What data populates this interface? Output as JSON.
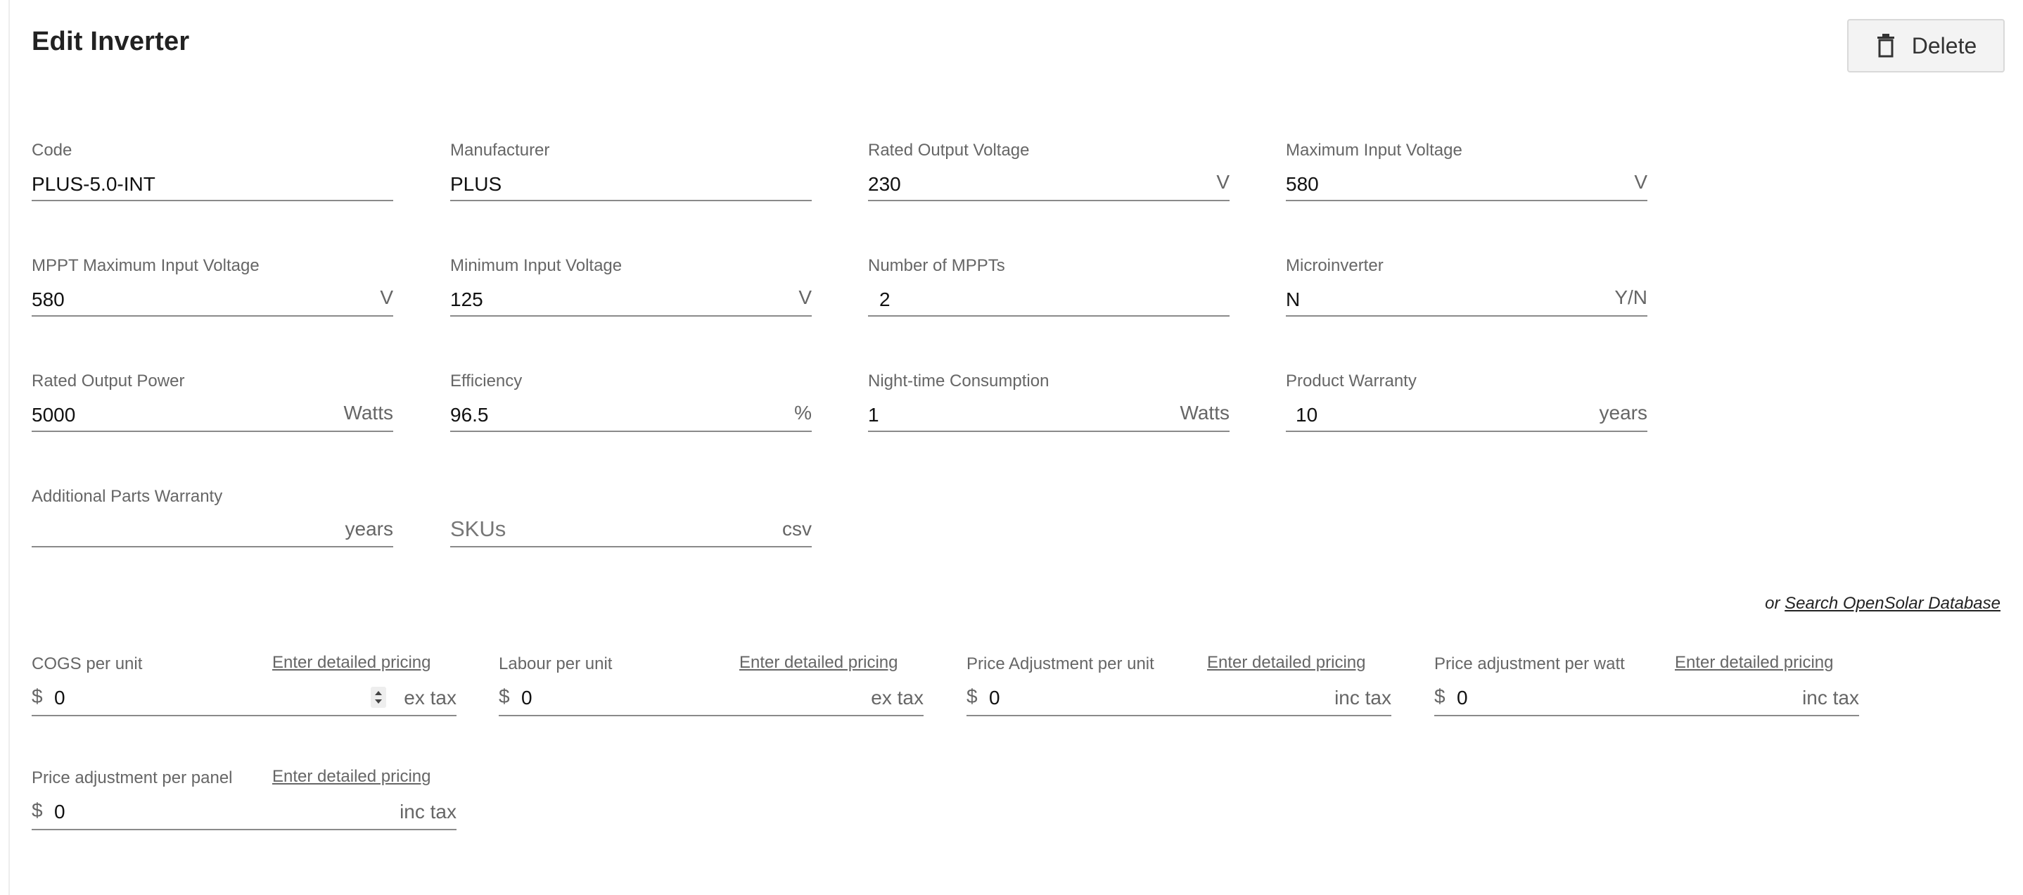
{
  "header": {
    "title": "Edit Inverter",
    "delete_label": "Delete"
  },
  "fields": {
    "code": {
      "label": "Code",
      "value": "PLUS-5.0-INT"
    },
    "manufacturer": {
      "label": "Manufacturer",
      "value": "PLUS"
    },
    "rated_output_voltage": {
      "label": "Rated Output Voltage",
      "value": "230",
      "unit": "V"
    },
    "max_input_voltage": {
      "label": "Maximum Input Voltage",
      "value": "580",
      "unit": "V"
    },
    "mppt_max_input_voltage": {
      "label": "MPPT Maximum Input Voltage",
      "value": "580",
      "unit": "V"
    },
    "min_input_voltage": {
      "label": "Minimum Input Voltage",
      "value": "125",
      "unit": "V"
    },
    "num_mppts": {
      "label": "Number of MPPTs",
      "value": "2"
    },
    "microinverter": {
      "label": "Microinverter",
      "value": "N",
      "unit": "Y/N"
    },
    "rated_output_power": {
      "label": "Rated Output Power",
      "value": "5000",
      "unit": "Watts"
    },
    "efficiency": {
      "label": "Efficiency",
      "value": "96.5",
      "unit": "%"
    },
    "night_consumption": {
      "label": "Night-time Consumption",
      "value": "1",
      "unit": "Watts"
    },
    "product_warranty": {
      "label": "Product Warranty",
      "value": "10",
      "unit": "years"
    },
    "additional_parts_warranty": {
      "label": "Additional Parts Warranty",
      "value": "",
      "unit": "years"
    },
    "skus": {
      "placeholder": "SKUs",
      "unit": "csv"
    }
  },
  "search_db": {
    "or": "or",
    "link": "Search OpenSolar Database"
  },
  "pricing": {
    "link_label": "Enter detailed pricing",
    "currency": "$",
    "cogs": {
      "label": "COGS per unit",
      "value": "0",
      "unit": "ex tax"
    },
    "labour": {
      "label": "Labour per unit",
      "value": "0",
      "unit": "ex tax"
    },
    "price_adj_unit": {
      "label": "Price Adjustment per unit",
      "value": "0",
      "unit": "inc tax"
    },
    "price_adj_watt": {
      "label": "Price adjustment per watt",
      "value": "0",
      "unit": "inc tax"
    },
    "price_adj_panel": {
      "label": "Price adjustment per panel",
      "value": "0",
      "unit": "inc tax"
    }
  },
  "icons": {
    "delete": "trash-icon",
    "spinner": "spinner-arrows-icon"
  }
}
